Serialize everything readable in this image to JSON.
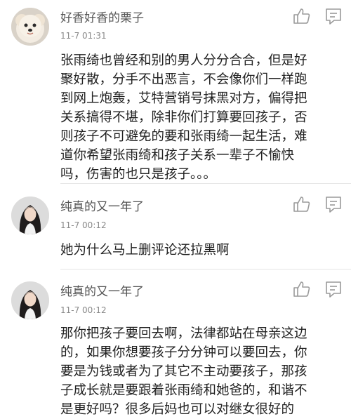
{
  "comments": [
    {
      "username": "好香好香的栗子",
      "timestamp": "11-7 01:31",
      "avatar": "dog-avatar",
      "text": "张雨绮也曾经和别的男人分分合合，但是好\n聚好散，分手不出恶言，不会像你们一样跑\n到网上炮轰，艾特营销号抹黑对方，偏得把\n关系搞得不堪，除非你们打算要回孩子，否\n则孩子不可避免的要和张雨绮一起生活，难\n道你希望张雨绮和孩子关系一辈子不愉快\n吗，伤害的也只是孩子。。。"
    },
    {
      "username": "纯真的又一年了",
      "timestamp": "11-7 00:12",
      "avatar": "woman-avatar",
      "text": "她为什么马上删评论还拉黑啊"
    },
    {
      "username": "纯真的又一年了",
      "timestamp": "11-7 00:12",
      "avatar": "woman-avatar",
      "text": "那你把孩子要回去啊，法律都站在母亲这边\n的，如果你想要孩子分分钟可以要回去，你\n要是为钱或者为了其它不主动要孩子，那孩\n子成长就是要跟着张雨绮和她爸的，和谐不\n是更好吗？很多后妈也可以对继女很好的"
    }
  ],
  "colors": {
    "username": "#555555",
    "meta": "#888888",
    "text": "#222222",
    "icon": "#9a9a9a",
    "divider": "#e6e6e6"
  },
  "icons": [
    "like-icon",
    "comment-icon"
  ]
}
